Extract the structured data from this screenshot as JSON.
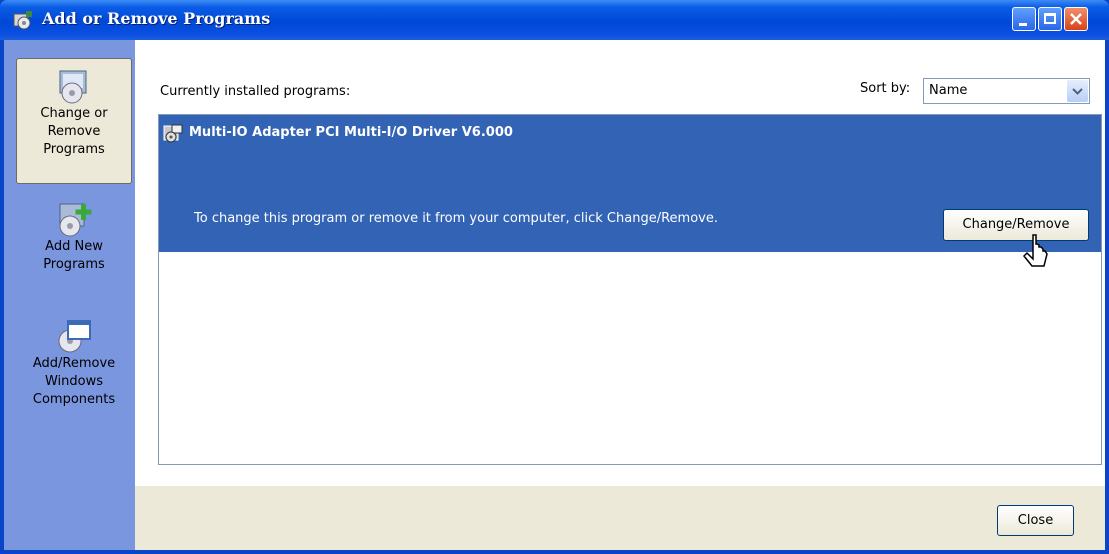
{
  "window": {
    "title": "Add or Remove Programs",
    "controls": [
      "minimize-icon",
      "maximize-icon",
      "close-icon"
    ]
  },
  "sidebar": {
    "items": [
      {
        "label_lines": [
          "Change or",
          "Remove",
          "Programs"
        ],
        "icon": "change-remove-programs-icon",
        "selected": true
      },
      {
        "label_lines": [
          "Add New",
          "Programs"
        ],
        "icon": "add-new-programs-icon",
        "selected": false
      },
      {
        "label_lines": [
          "Add/Remove",
          "Windows",
          "Components"
        ],
        "icon": "windows-components-icon",
        "selected": false
      }
    ]
  },
  "main": {
    "installed_label": "Currently installed programs:",
    "sort_label": "Sort by:",
    "sort_value": "Name",
    "programs": [
      {
        "name": "Multi-IO Adapter PCI Multi-I/O Driver V6.000",
        "hint": "To change this program or remove it from your computer, click Change/Remove.",
        "action_label": "Change/Remove",
        "icon": "installer-icon"
      }
    ]
  },
  "footer": {
    "close_label": "Close"
  },
  "colors": {
    "titlebar": "#0048d8",
    "sidebar": "#7a96df",
    "selection": "#3263b5",
    "client": "#ece9d8"
  }
}
